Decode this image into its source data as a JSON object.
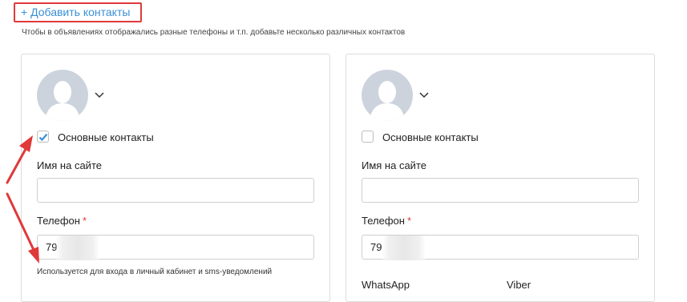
{
  "add_contacts": {
    "label": "+ Добавить контакты"
  },
  "hint": "Чтобы в объявлениях отображались разные телефоны и т.п. добавьте несколько различных контактов",
  "cards": [
    {
      "main_contacts_label": "Основные контакты",
      "main_contacts_checked": true,
      "site_name_label": "Имя на сайте",
      "site_name_value": "",
      "phone_label": "Телефон",
      "phone_required_mark": "*",
      "phone_value": "79          5",
      "phone_note": "Используется для входа в личный кабинет и sms-уведомлений"
    },
    {
      "main_contacts_label": "Основные контакты",
      "main_contacts_checked": false,
      "site_name_label": "Имя на сайте",
      "site_name_value": "",
      "phone_label": "Телефон",
      "phone_required_mark": "*",
      "phone_value": "79          9",
      "messengers": {
        "whatsapp": "WhatsApp",
        "viber": "Viber"
      }
    }
  ],
  "colors": {
    "accent": "#3a8fd6",
    "annotation_red": "#e0393a",
    "avatar_bg": "#ccd3dc"
  },
  "icons": {
    "avatar": "user-silhouette-icon",
    "chevron": "chevron-down-icon",
    "check": "checkmark-icon"
  }
}
